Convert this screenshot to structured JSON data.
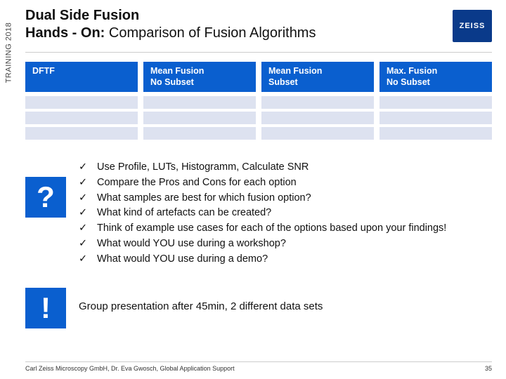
{
  "sidebar": {
    "label": "TRAINING 2018"
  },
  "header": {
    "line1": "Dual Side Fusion",
    "line2_bold": "Hands - On:",
    "line2_rest": " Comparison of Fusion Algorithms",
    "logo": "ZEISS"
  },
  "table": {
    "headers": [
      "DFTF",
      "Mean Fusion\nNo Subset",
      "Mean Fusion\nSubset",
      "Max. Fusion\nNo Subset"
    ]
  },
  "questions": {
    "badge": "?",
    "items": [
      "Use Profile, LUTs, Histogramm, Calculate SNR",
      "Compare the Pros and Cons for each option",
      "What samples are best for which fusion option?",
      "What kind of artefacts can be created?",
      "Think of example use cases for each of the options based upon your findings!",
      "What would YOU use during a workshop?",
      "What would YOU use during a demo?"
    ],
    "check": "✓"
  },
  "group": {
    "badge": "!",
    "text": "Group presentation after 45min,  2 different data sets"
  },
  "footer": {
    "left": "Carl Zeiss Microscopy GmbH, Dr. Eva Gwosch, Global Application Support",
    "right": "35"
  }
}
